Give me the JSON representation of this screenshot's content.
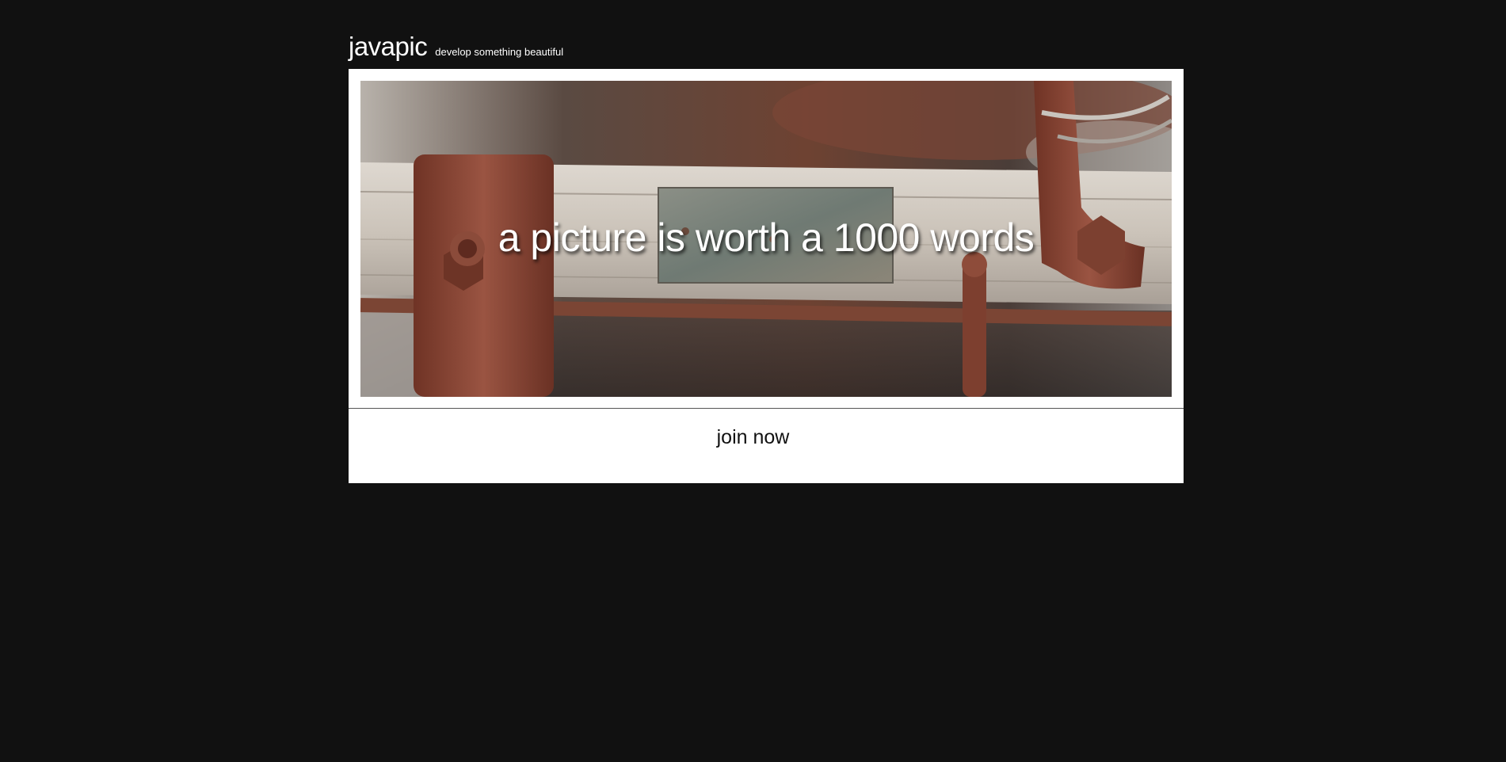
{
  "header": {
    "logo": "javapic",
    "tagline": "develop something beautiful"
  },
  "hero": {
    "caption": "a picture is worth a 1000 words",
    "image_description_icon": "rusty-hardware-photo"
  },
  "cta": {
    "label": "join now"
  },
  "colors": {
    "background": "#111111",
    "card": "#ffffff",
    "rust": "#8a4a38",
    "wood": "#cfc8bf"
  }
}
